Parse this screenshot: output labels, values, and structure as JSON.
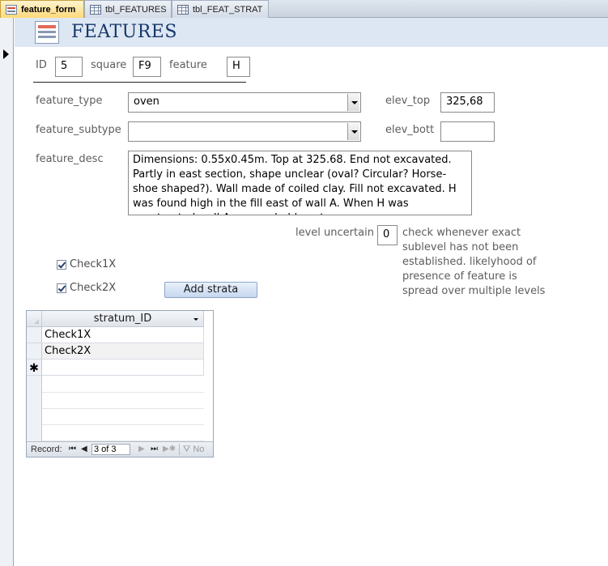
{
  "tabs": [
    {
      "label": "feature_form",
      "icon": "form-icon",
      "active": true
    },
    {
      "label": "tbl_FEATURES",
      "icon": "table-icon",
      "active": false
    },
    {
      "label": "tbl_FEAT_STRAT",
      "icon": "table-icon",
      "active": false
    }
  ],
  "header": {
    "title": "FEATURES",
    "icon": "form-icon"
  },
  "fields": {
    "id_label": "ID",
    "id_value": "5",
    "square_label": "square",
    "square_value": "F9",
    "feature_label": "feature",
    "feature_value": "H",
    "feature_type_label": "feature_type",
    "feature_type_value": "oven",
    "feature_subtype_label": "feature_subtype",
    "feature_subtype_value": "",
    "feature_desc_label": "feature_desc",
    "feature_desc_value": "Dimensions: 0.55x0.45m. Top at 325.68. End not excavated. Partly in east section, shape unclear (oval? Circular? Horse-shoe shaped?). Wall made of coiled clay. Fill not excavated. H was found high in the fill east of wall A. When H was constructed wall A was probably not",
    "elev_top_label": "elev_top",
    "elev_top_value": "325,68",
    "elev_bott_label": "elev_bott",
    "elev_bott_value": "",
    "level_uncertain_label": "level uncertain",
    "level_uncertain_value": "0",
    "level_uncertain_note": "check whenever exact sublevel has not been established. likelyhood of presence of feature is spread over multiple levels"
  },
  "checkboxes": [
    {
      "label": "Check1X",
      "checked": true
    },
    {
      "label": "Check2X",
      "checked": true
    }
  ],
  "add_strata_button": "Add strata",
  "subform": {
    "column_header": "stratum_ID",
    "rows": [
      "Check1X",
      "Check2X"
    ],
    "new_row_marker": "✱",
    "navigation": {
      "record_label": "Record:",
      "current": "3 of 3",
      "filter_label": "No"
    }
  },
  "colors": {
    "header_bg": "#dde7f3",
    "title_color": "#17376a",
    "active_tab": "#ffd97a",
    "label_color": "#5d5d5d"
  }
}
